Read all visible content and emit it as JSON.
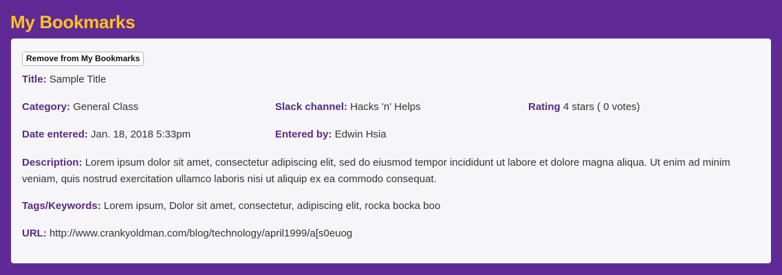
{
  "page": {
    "title": "My Bookmarks"
  },
  "bookmark": {
    "remove_button_label": "Remove from My Bookmarks",
    "title_label": "Title:",
    "title_value": "Sample Title",
    "category_label": "Category:",
    "category_value": "General Class",
    "slack_label": "Slack channel:",
    "slack_value": "Hacks 'n' Helps",
    "rating_label": "Rating",
    "rating_value": "4 stars ( 0 votes)",
    "date_label": "Date entered:",
    "date_value": "Jan. 18, 2018 5:33pm",
    "entered_by_label": "Entered by:",
    "entered_by_value": "Edwin Hsia",
    "description_label": "Description:",
    "description_value": "Lorem ipsum dolor sit amet, consectetur adipiscing elit, sed do eiusmod tempor incididunt ut labore et dolore magna aliqua. Ut enim ad minim veniam, quis nostrud exercitation ullamco laboris nisi ut aliquip ex ea commodo consequat.",
    "tags_label": "Tags/Keywords:",
    "tags_value": "Lorem ipsum, Dolor sit amet, consectetur, adipiscing elit, rocka bocka boo",
    "url_label": "URL:",
    "url_value": "http://www.crankyoldman.com/blog/technology/april1999/a[s0euog"
  },
  "colors": {
    "background": "#5f2a96",
    "title": "#ffc21e",
    "label": "#5a2a82",
    "card": "#f6f6f8"
  }
}
